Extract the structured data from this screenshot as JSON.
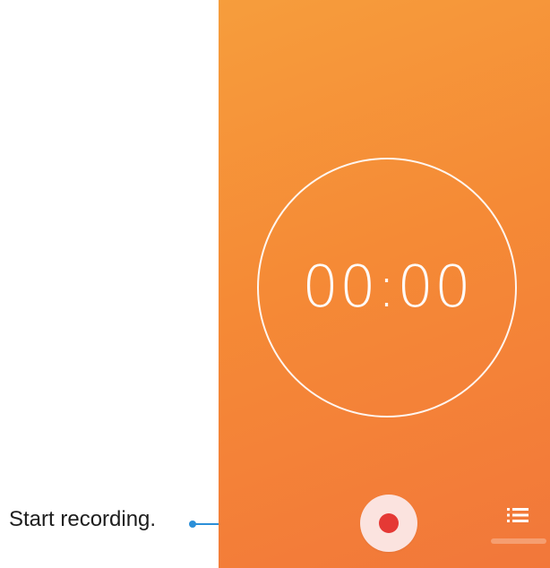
{
  "recorder": {
    "timer": "00:00",
    "record_color": "#e53935",
    "background_top": "#f69d3c",
    "background_bottom": "#f2773a"
  },
  "callout": {
    "label": "Start recording.",
    "line_color": "#2b8fd8"
  },
  "icons": {
    "record": "record-icon",
    "list": "list-icon"
  }
}
